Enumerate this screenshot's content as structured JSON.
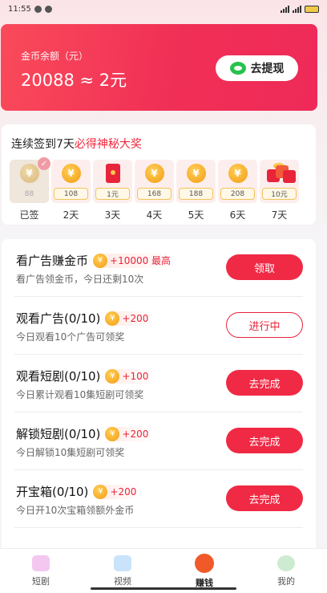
{
  "status": {
    "time": "11:55",
    "battery": "24"
  },
  "balance": {
    "label": "金币余额（元）",
    "value": "20088 ≈ 2元",
    "withdraw_label": "去提现"
  },
  "checkin": {
    "title_prefix": "连续签到7天",
    "title_highlight": "必得神秘大奖",
    "days": [
      {
        "amount": "88",
        "label": "已签",
        "kind": "coin",
        "done": true
      },
      {
        "amount": "108",
        "label": "2天",
        "kind": "coin"
      },
      {
        "amount": "1元",
        "label": "3天",
        "kind": "redpacket"
      },
      {
        "amount": "168",
        "label": "4天",
        "kind": "coin"
      },
      {
        "amount": "188",
        "label": "5天",
        "kind": "coin"
      },
      {
        "amount": "208",
        "label": "6天",
        "kind": "coin"
      },
      {
        "amount": "10元",
        "label": "7天",
        "kind": "gift"
      }
    ]
  },
  "tasks": [
    {
      "title": "看广告赚金币",
      "reward": "+10000 最高",
      "desc": "看广告领金币，今日还剩10次",
      "button": "领取",
      "style": "filled"
    },
    {
      "title": "观看广告(0/10)",
      "reward": "+200",
      "desc": "今日观看10个广告可领奖",
      "button": "进行中",
      "style": "outline"
    },
    {
      "title": "观看短剧(0/10)",
      "reward": "+100",
      "desc": "今日累计观看10集短剧可领奖",
      "button": "去完成",
      "style": "filled"
    },
    {
      "title": "解锁短剧(0/10)",
      "reward": "+200",
      "desc": "今日解锁10集短剧可领奖",
      "button": "去完成",
      "style": "filled"
    },
    {
      "title": "开宝箱(0/10)",
      "reward": "+200",
      "desc": "今日开10次宝箱领额外金币",
      "button": "去完成",
      "style": "filled"
    }
  ],
  "tabs": [
    {
      "label": "短剧",
      "icon": "short-drama-icon"
    },
    {
      "label": "视频",
      "icon": "video-icon"
    },
    {
      "label": "赚钱",
      "icon": "earn-icon",
      "active": true
    },
    {
      "label": "我的",
      "icon": "profile-icon"
    }
  ],
  "colors": {
    "accent": "#f02a45",
    "coin": "#f39b14"
  }
}
